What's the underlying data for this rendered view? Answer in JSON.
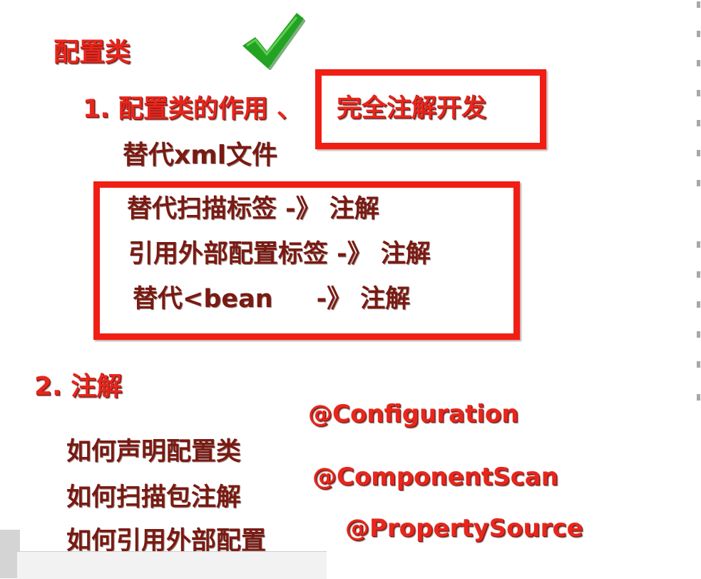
{
  "slide": {
    "title": "配置类",
    "point1_prefix": "1. 配置类的作用 、",
    "point1_boxed": "完全注解开发",
    "replace_xml": "替代xml文件",
    "box_lines": [
      "替代扫描标签 -》 注解",
      "引用外部配置标签 -》 注解",
      "替代<bean     -》 注解"
    ],
    "point2": "2. 注解",
    "questions": [
      "如何声明配置类",
      "如何扫描包注解",
      "如何引用外部配置"
    ],
    "annotations": [
      "@Configuration",
      "@ComponentScan",
      "@PropertySource"
    ]
  },
  "icons": {
    "check": "checkmark-icon"
  },
  "colors": {
    "text_red": "#e8261c",
    "text_dark": "#7a1a12",
    "box_border": "#f01e14",
    "check_green": "#1e9a1e"
  }
}
